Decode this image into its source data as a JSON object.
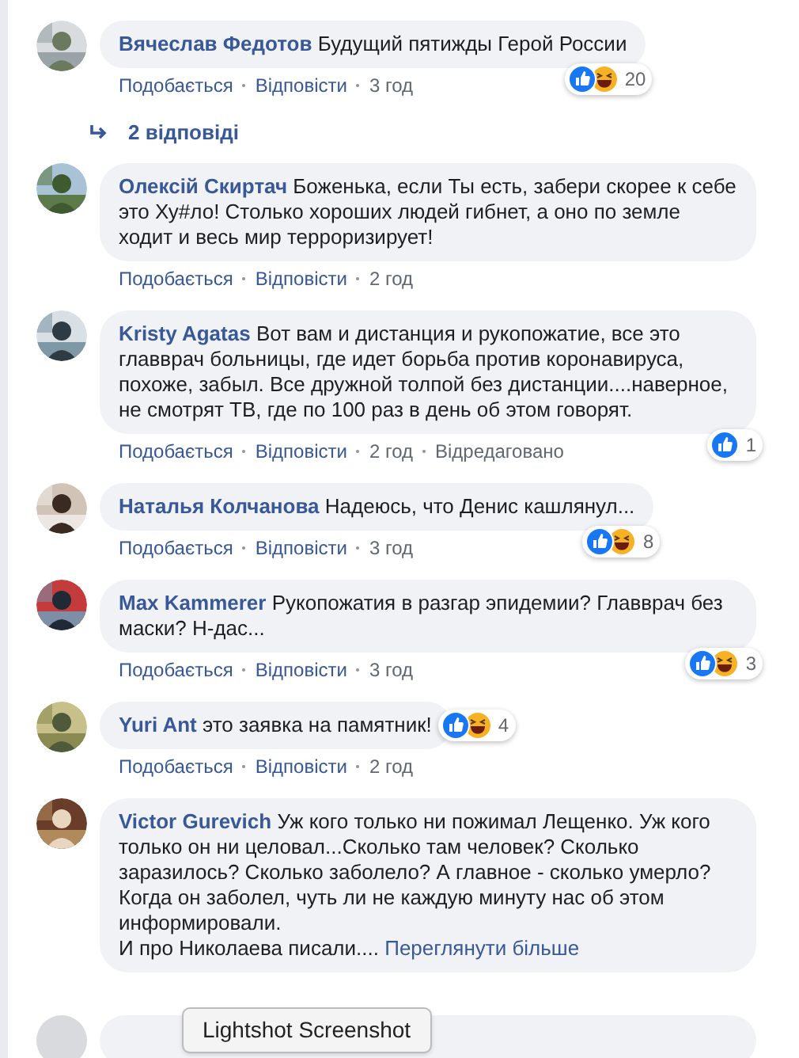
{
  "comments": [
    {
      "author": "Вячеслав Федотов",
      "text": "Будущий пятижды Герой России",
      "actions": [
        "Подобається",
        "Відповісти"
      ],
      "time": "3 год",
      "reactions": [
        {
          "kind": "like"
        },
        {
          "kind": "haha"
        }
      ],
      "reaction_count": "20",
      "replies": "2 відповіді",
      "avatar": {
        "kind": "picture"
      }
    },
    {
      "author": "Олексій Скиртач",
      "text": "Боженька, если Ты есть, забери скорее к себе это Ху#ло! Столько хороших людей гибнет, а оно по земле ходит и весь мир терроризирует!",
      "actions": [
        "Подобається",
        "Відповісти"
      ],
      "time": "2 год",
      "avatar": {
        "kind": "picture"
      }
    },
    {
      "author": "Kristy Agatas",
      "text": "Вот вам и дистанция и рукопожатие, все это главврач больницы, где идет борьба против коронавируса, похоже, забыл. Все дружной толпой без дистанции....наверное, не смотрят ТВ, где по 100 раз в день об этом говорят.",
      "actions": [
        "Подобається",
        "Відповісти"
      ],
      "time": "2 год",
      "edited": "Відредаговано",
      "reactions": [
        {
          "kind": "like"
        }
      ],
      "reaction_count": "1",
      "avatar": {
        "kind": "picture"
      }
    },
    {
      "author": "Наталья Колчанова",
      "text": "Надеюсь, что Денис кашлянул...",
      "actions": [
        "Подобається",
        "Відповісти"
      ],
      "time": "3 год",
      "reactions": [
        {
          "kind": "like"
        },
        {
          "kind": "haha"
        }
      ],
      "reaction_count": "8",
      "avatar": {
        "kind": "picture"
      }
    },
    {
      "author": "Max Kammerer",
      "text": "Рукопожатия в разгар эпидемии? Главврач без маски? Н-дас...",
      "actions": [
        "Подобається",
        "Відповісти"
      ],
      "time": "3 год",
      "reactions": [
        {
          "kind": "like"
        },
        {
          "kind": "haha"
        }
      ],
      "reaction_count": "3",
      "avatar": {
        "kind": "picture"
      }
    },
    {
      "author": "Yuri Ant",
      "text": "это заявка на памятник!",
      "actions": [
        "Подобається",
        "Відповісти"
      ],
      "time": "2 год",
      "reactions": [
        {
          "kind": "like"
        },
        {
          "kind": "haha"
        }
      ],
      "reaction_count": "4",
      "avatar": {
        "kind": "picture"
      }
    },
    {
      "author": "Victor Gurevich",
      "text": "Уж кого только ни пожимал Лещенко. Уж кого только он ни целовал...Сколько там человек? Сколько заразилось? Сколько заболело? А главное - сколько умерло? Когда он заболел, чуть ли не каждую минуту нас об этом информировали.\nИ про Николаева писали....",
      "see_more": "Переглянути більше",
      "avatar": {
        "kind": "picture"
      }
    }
  ],
  "tooltip": "Lightshot Screenshot"
}
